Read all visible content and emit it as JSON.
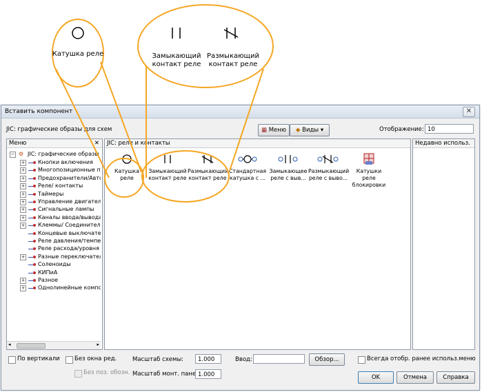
{
  "callouts": {
    "coil": {
      "symbol": "O",
      "label": "Катушка реле"
    },
    "nc_contact": {
      "symbol": "II",
      "label": "Замыкающий\nконтакт реле"
    },
    "no_contact": {
      "symbol": "N",
      "label": "Размыкающий\nконтакт реле"
    }
  },
  "dialog": {
    "title": "Вставить компонент",
    "library_title": "JIC: графические образы для схем",
    "menu_button": "Меню",
    "views_button": "Виды",
    "display_label": "Отображение:",
    "display_value": "10"
  },
  "tree": {
    "header": "Меню",
    "root": "JIC: графические образы для",
    "items": [
      {
        "label": "Кнопки включения",
        "expandable": true
      },
      {
        "label": "Многопозиционные пере",
        "expandable": true
      },
      {
        "label": "Предохранители/Автома",
        "expandable": true
      },
      {
        "label": "Реле/ контакты",
        "expandable": true
      },
      {
        "label": "Таймеры",
        "expandable": true
      },
      {
        "label": "Управление двигателем",
        "expandable": true
      },
      {
        "label": "Сигнальные лампы",
        "expandable": true
      },
      {
        "label": "Каналы ввода/вывода П",
        "expandable": true
      },
      {
        "label": "Клеммы/ Соединители",
        "expandable": true
      },
      {
        "label": "Концевые выключатели",
        "expandable": false
      },
      {
        "label": "Реле давления/температ",
        "expandable": false
      },
      {
        "label": "Реле расхода/уровня",
        "expandable": false
      },
      {
        "label": "Разные переключатели",
        "expandable": true
      },
      {
        "label": "Соленоиды",
        "expandable": false
      },
      {
        "label": "КИПиА",
        "expandable": false
      },
      {
        "label": "Разное",
        "expandable": true
      },
      {
        "label": "Однолинейные компонен",
        "expandable": true
      }
    ]
  },
  "components": {
    "header": "JIC: реле и контакты",
    "items": [
      {
        "symbol": "O",
        "label": "Катушка реле"
      },
      {
        "symbol": "| |",
        "label": "Замыкающий контакт реле"
      },
      {
        "symbol": "N",
        "label": "Размыкающий контакт реле"
      },
      {
        "symbol": "o-O-o",
        "label": "Стандартная катушка с ..."
      },
      {
        "symbol": "o| |o",
        "label": "Замыкающее реле с выв..."
      },
      {
        "symbol": "oNo",
        "label": "Размыкающий реле с выво..."
      },
      {
        "symbol": "[+]",
        "label": "Катушки реле блокировки"
      }
    ]
  },
  "recent": {
    "header": "Недавно использ."
  },
  "bottom": {
    "vertical_label": "По вертикали",
    "no_ref_window_label": "Без окна ред.",
    "no_pos_label": "Без поз. обозн.",
    "scale_label": "Масштаб схемы:",
    "scale_value": "1.000",
    "panel_scale_label": "Масштаб монт. панели:",
    "panel_scale_value": "1.000",
    "input_label": "Ввод:",
    "input_value": "",
    "browse_button": "Обзор...",
    "always_show_label": "Всегда отобр. ранее использ.меню",
    "ok_button": "OK",
    "cancel_button": "Отмена",
    "help_button": "Справка"
  },
  "colors": {
    "callout": "#f5a623",
    "tree_icon_line": "#3a4fb4",
    "tree_icon_dot": "#c03030"
  }
}
